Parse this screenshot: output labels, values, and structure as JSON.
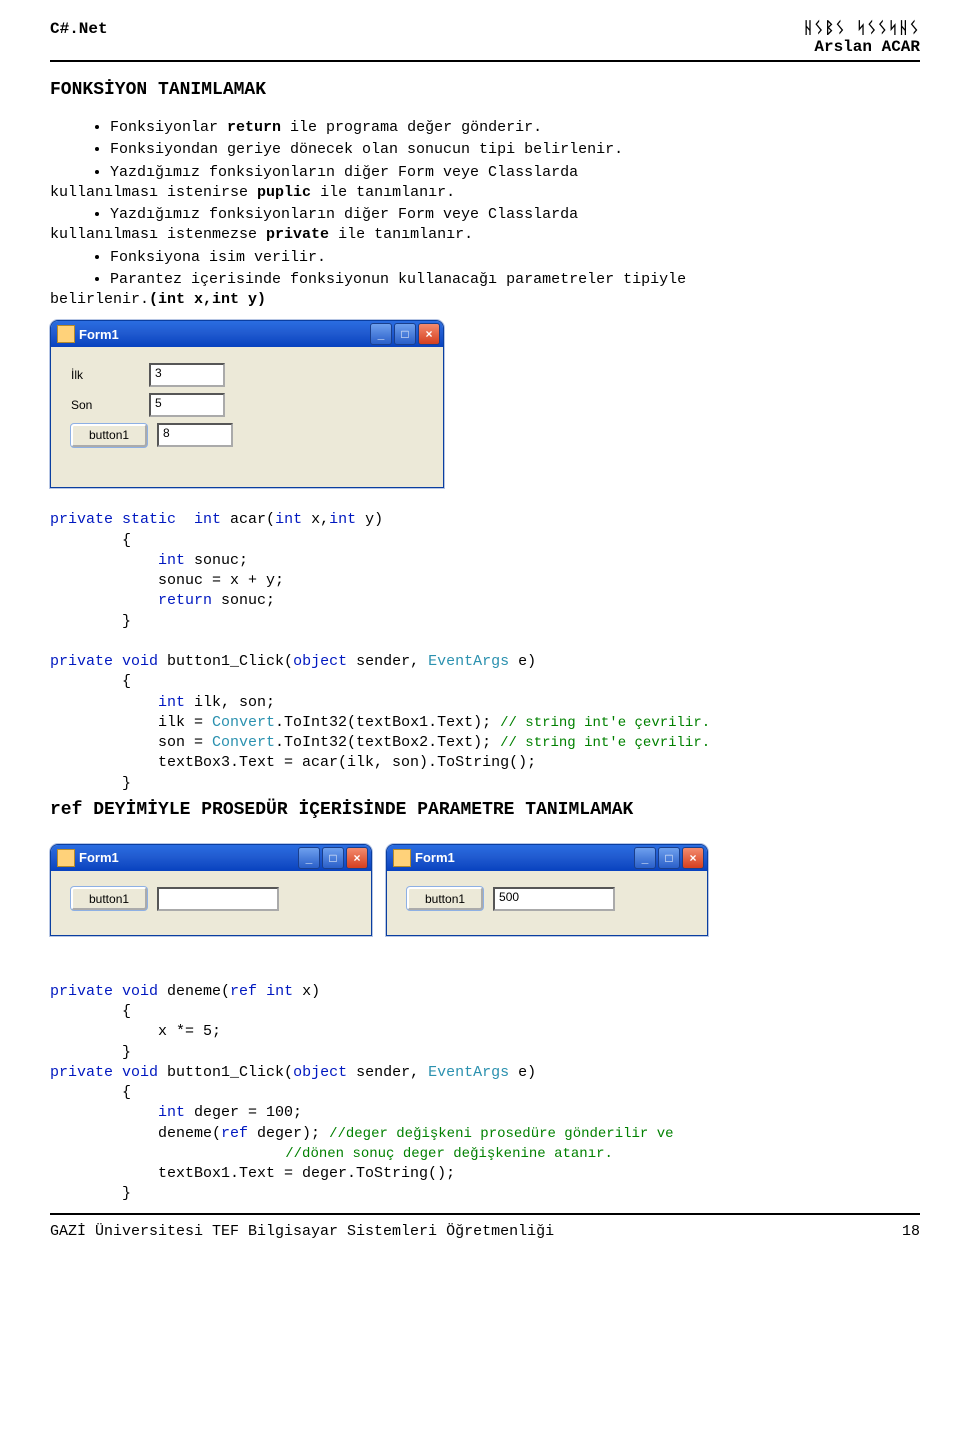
{
  "header": {
    "left": "C#.Net",
    "right_decorative": "ᚺᛊᛒᛊ  ᛋᛊᛊᛋᚺᛊ",
    "right_author": "Arslan ACAR"
  },
  "section1": {
    "title": "FONKSİYON TANIMLAMAK",
    "bullets": {
      "b1a": "Fonksiyonlar ",
      "b1b": "return",
      "b1c": " ile programa değer gönderir.",
      "b2": "Fonksiyondan geriye dönecek olan sonucun tipi belirlenir.",
      "b3a": "Yazdığımız fonksiyonların diğer Form veye Classlarda ",
      "b3pre": "kullanılması istenirse ",
      "b3b": "puplic",
      "b3c": " ile tanımlanır.",
      "b4a": "Yazdığımız fonksiyonların diğer Form veye Classlarda ",
      "b4pre": "kullanılması istenmezse ",
      "b4b": "private",
      "b4c": " ile tanımlanır.",
      "b5": "Fonksiyona isim verilir.",
      "b6a": "Parantez içerisinde fonksiyonun kullanacağı parametreler tipiyle ",
      "b6pre": "belirlenir.",
      "b6b": "(int x,int y)"
    }
  },
  "form1": {
    "title": "Form1",
    "ilk_label": "İlk",
    "ilk_value": "3",
    "son_label": "Son",
    "son_value": "5",
    "button_label": "button1",
    "result_value": "8",
    "min_glyph": "_",
    "max_glyph": "□",
    "close_glyph": "×"
  },
  "code1": {
    "l1a": "private",
    "l1b": " static",
    "l1c": "  int",
    "l1d": " acar(",
    "l1e": "int",
    "l1f": " x,",
    "l1g": "int",
    "l1h": " y)",
    "l2": "        {",
    "l3a": "            int",
    "l3b": " sonuc;",
    "l4": "            sonuc = x + y;",
    "l5a": "            return",
    "l5b": " sonuc;",
    "l6": "        }",
    "l7a": "private",
    "l7b": " void",
    "l7c": " button1_Click(",
    "l7d": "object",
    "l7e": " sender, ",
    "l7f": "EventArgs",
    "l7g": " e)",
    "l8": "        {",
    "l9a": "            int",
    "l9b": " ilk, son;",
    "l10a": "            ilk = ",
    "l10b": "Convert",
    "l10c": ".ToInt32(textBox1.Text); ",
    "l10d": "// string int'e çevrilir.",
    "l11a": "            son = ",
    "l11b": "Convert",
    "l11c": ".ToInt32(textBox2.Text); ",
    "l11d": "// string int'e çevrilir.",
    "l12": "            textBox3.Text = acar(ilk, son).ToString();",
    "l13": "        }"
  },
  "section2": {
    "title": "ref DEYİMİYLE PROSEDÜR İÇERİSİNDE PARAMETRE TANIMLAMAK"
  },
  "form2": {
    "title": "Form1",
    "button_label": "button1",
    "value": ""
  },
  "form3": {
    "title": "Form1",
    "button_label": "button1",
    "value": "500"
  },
  "code2": {
    "l1a": "private",
    "l1b": " void",
    "l1c": " deneme(",
    "l1d": "ref",
    "l1e": " int",
    "l1f": " x)",
    "l2": "        {",
    "l3": "            x *= 5;",
    "l4": "        }",
    "l5a": "private",
    "l5b": " void",
    "l5c": " button1_Click(",
    "l5d": "object",
    "l5e": " sender, ",
    "l5f": "EventArgs",
    "l5g": " e)",
    "l6": "        {",
    "l7a": "            int",
    "l7b": " deger = 100;",
    "l8a": "            deneme(",
    "l8b": "ref",
    "l8c": " deger); ",
    "l8d": "//deger değişkeni prosedüre gönderilir ve",
    "l9": "                            //dönen sonuç deger değişkenine atanır.",
    "l10": "            textBox1.Text = deger.ToString();",
    "l11": "        }"
  },
  "footer": {
    "left": "GAZİ Üniversitesi TEF Bilgisayar Sistemleri Öğretmenliği",
    "right": "18"
  }
}
